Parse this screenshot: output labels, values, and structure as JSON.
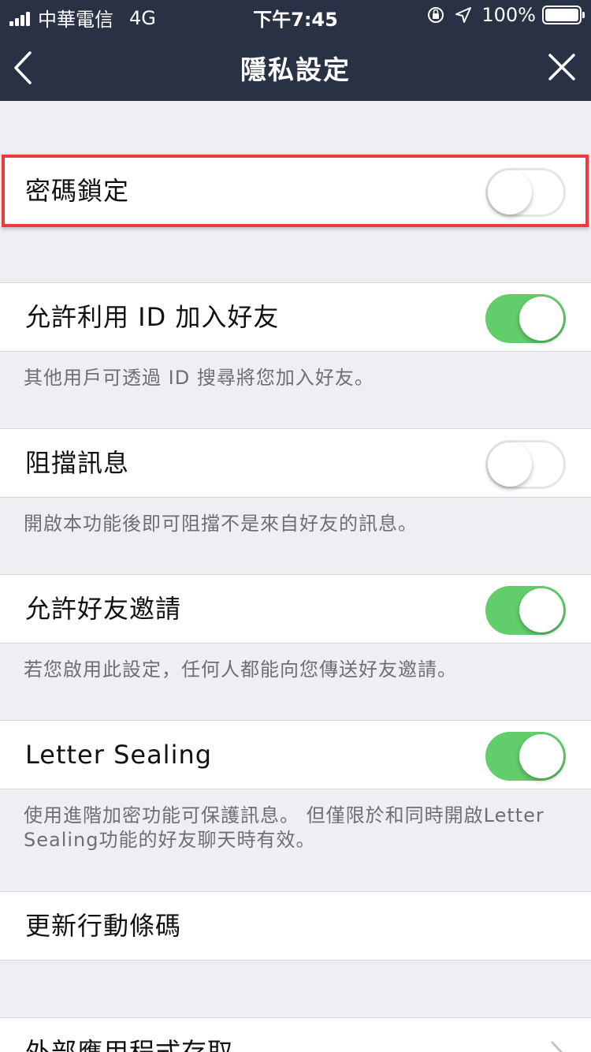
{
  "status_bar": {
    "carrier": "中華電信",
    "network": "4G",
    "time": "下午7:45",
    "battery": "100%",
    "icons": [
      "signal-icon",
      "rotation-lock-icon",
      "location-icon",
      "battery-icon"
    ]
  },
  "nav": {
    "title": "隱私設定",
    "back_icon": "chevron-left-icon",
    "close_icon": "close-icon"
  },
  "settings": {
    "passcode_lock": {
      "label": "密碼鎖定",
      "enabled": false,
      "highlighted": true
    },
    "allow_id_add": {
      "label": "允許利用 ID 加入好友",
      "enabled": true,
      "description": "其他用戶可透過 ID 搜尋將您加入好友。"
    },
    "block_messages": {
      "label": "阻擋訊息",
      "enabled": false,
      "description": "開啟本功能後即可阻擋不是來自好友的訊息。"
    },
    "allow_friend_invites": {
      "label": "允許好友邀請",
      "enabled": true,
      "description": "若您啟用此設定，任何人都能向您傳送好友邀請。"
    },
    "letter_sealing": {
      "label": "Letter Sealing",
      "enabled": true,
      "description_line1": "使用進階加密功能可保護訊息。 但僅限於和同時開啟Letter",
      "description_line2": "Sealing功能的好友聊天時有效。"
    },
    "update_qr": {
      "label": "更新行動條碼"
    },
    "external_app_access": {
      "label": "外部應用程式存取",
      "icon": "chevron-right-icon"
    }
  },
  "colors": {
    "header_bg": "#283244",
    "page_bg": "#eeeff2",
    "toggle_on": "#62cd6b",
    "highlight_border": "#ee3a3f"
  }
}
